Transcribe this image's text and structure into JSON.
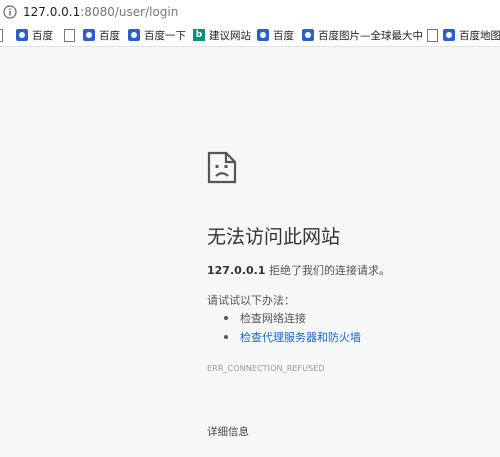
{
  "browser": {
    "url_host": "127.0.0.1",
    "url_rest": ":8080/user/login"
  },
  "bookmarks": [
    {
      "icon": "doc-icon",
      "label": ""
    },
    {
      "icon": "baidu-paw-icon",
      "label": "百度"
    },
    {
      "icon": "doc-icon",
      "label": ""
    },
    {
      "icon": "baidu-paw-icon",
      "label": "百度"
    },
    {
      "icon": "baidu-paw-icon",
      "label": "百度一下"
    },
    {
      "icon": "bing-icon",
      "label": "建议网站"
    },
    {
      "icon": "baidu-paw-icon",
      "label": "百度"
    },
    {
      "icon": "baidu-paw-icon",
      "label": "百度图片—全球最大中"
    },
    {
      "icon": "doc-icon",
      "label": ""
    },
    {
      "icon": "baidu-paw-icon",
      "label": "百度地图"
    }
  ],
  "error": {
    "title": "无法访问此网站",
    "host": "127.0.0.1",
    "message": "拒绝了我们的连接请求。",
    "try_heading": "请试试以下办法：",
    "suggestions": [
      {
        "text": "检查网络连接",
        "is_link": false
      },
      {
        "text": "检查代理服务器和防火墙",
        "is_link": true
      }
    ],
    "code": "ERR_CONNECTION_REFUSED",
    "details_label": "详细信息"
  },
  "colors": {
    "page_background": "#f7f7f7",
    "link": "#1a66d2",
    "baidu_blue": "#2a5fce"
  }
}
